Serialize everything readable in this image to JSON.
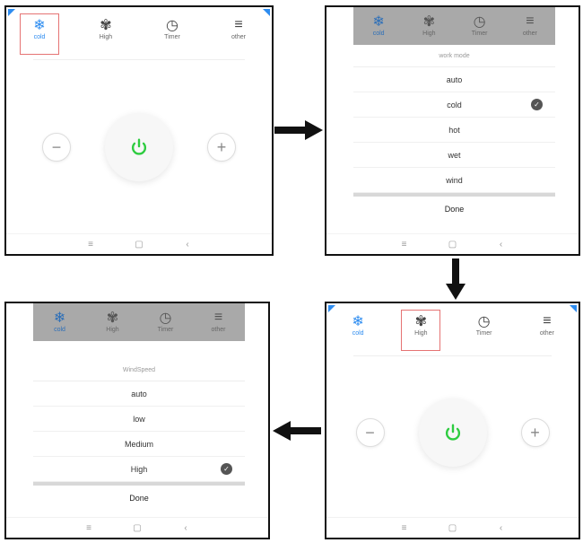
{
  "tabs": {
    "cold": "cold",
    "high": "High",
    "timer": "Timer",
    "other": "other"
  },
  "icons": {
    "cold": "snowflake-icon",
    "fan": "fan-icon",
    "timer": "clock-icon",
    "other": "menu-icon",
    "power": "power-icon",
    "minus": "minus-icon",
    "plus": "plus-icon"
  },
  "colors": {
    "accent": "#2d8cf0",
    "power": "#2ecc40",
    "highlight_box": "#e57373"
  },
  "controls": {
    "minus": "−",
    "plus": "+"
  },
  "work_mode": {
    "title": "work mode",
    "options": [
      "auto",
      "cold",
      "hot",
      "wet",
      "wind"
    ],
    "selected": "cold",
    "done": "Done"
  },
  "wind_speed": {
    "title": "WindSpeed",
    "options": [
      "auto",
      "low",
      "Medium",
      "High"
    ],
    "selected": "High",
    "done": "Done"
  },
  "nav": {
    "menu": "≡",
    "home": "▢",
    "back": "‹"
  }
}
